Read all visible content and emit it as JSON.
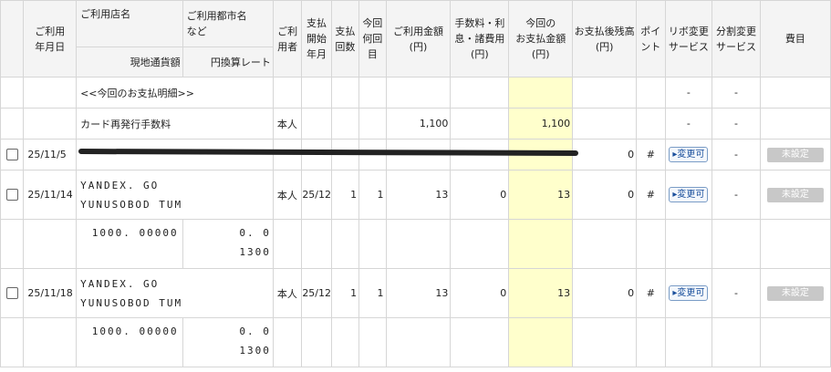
{
  "header": {
    "date": "ご利用\n年月日",
    "shop": "ご利用店名",
    "city": "ご利用都市名\nなど",
    "currency": "現地通貨額",
    "rate": "円換算レート",
    "user": "ご利\n用者",
    "pay_month": "支払\n開始\n年月",
    "count": "支払\n回数",
    "nth": "今回\n何回\n目",
    "amount": "ご利用金額\n(円)",
    "fee": "手数料・利\n息・諸費用\n(円)",
    "this_pay": "今回の\nお支払金額\n(円)",
    "balance": "お支払後残高\n(円)",
    "point": "ポイ\nント",
    "revo": "リボ変更\nサービス",
    "split": "分割変更\nサービス",
    "category": "費目"
  },
  "rows": {
    "section_label": "<<今回のお支払明細>>",
    "dash": "-",
    "fee_row": {
      "shop": "カード再発行手数料",
      "user": "本人",
      "amount": "1,100",
      "this_pay": "1,100"
    },
    "redacted_row": {
      "date": "25/11/5",
      "balance": "0",
      "point": "#"
    },
    "tx1": {
      "date": "25/11/14",
      "shop1": "YANDEX. GO",
      "shop2": "YUNUSOBOD TUM",
      "user": "本人",
      "month": "25/12",
      "count": "1",
      "nth": "1",
      "amount": "13",
      "fee": "0",
      "this_pay": "13",
      "balance": "0",
      "point": "#",
      "foreign": "1000. 00000",
      "rate1": "0. 0",
      "rate2": "1300"
    },
    "tx2": {
      "date": "25/11/18",
      "shop1": "YANDEX. GO",
      "shop2": "YUNUSOBOD TUM",
      "user": "本人",
      "month": "25/12",
      "count": "1",
      "nth": "1",
      "amount": "13",
      "fee": "0",
      "this_pay": "13",
      "balance": "0",
      "point": "#",
      "foreign": "1000. 00000",
      "rate1": "0. 0",
      "rate2": "1300"
    }
  },
  "buttons": {
    "change": "▸変更可",
    "unset": "未設定"
  },
  "colors": {
    "highlight": "#ffffcc",
    "header_bg": "#f4f4f4"
  }
}
